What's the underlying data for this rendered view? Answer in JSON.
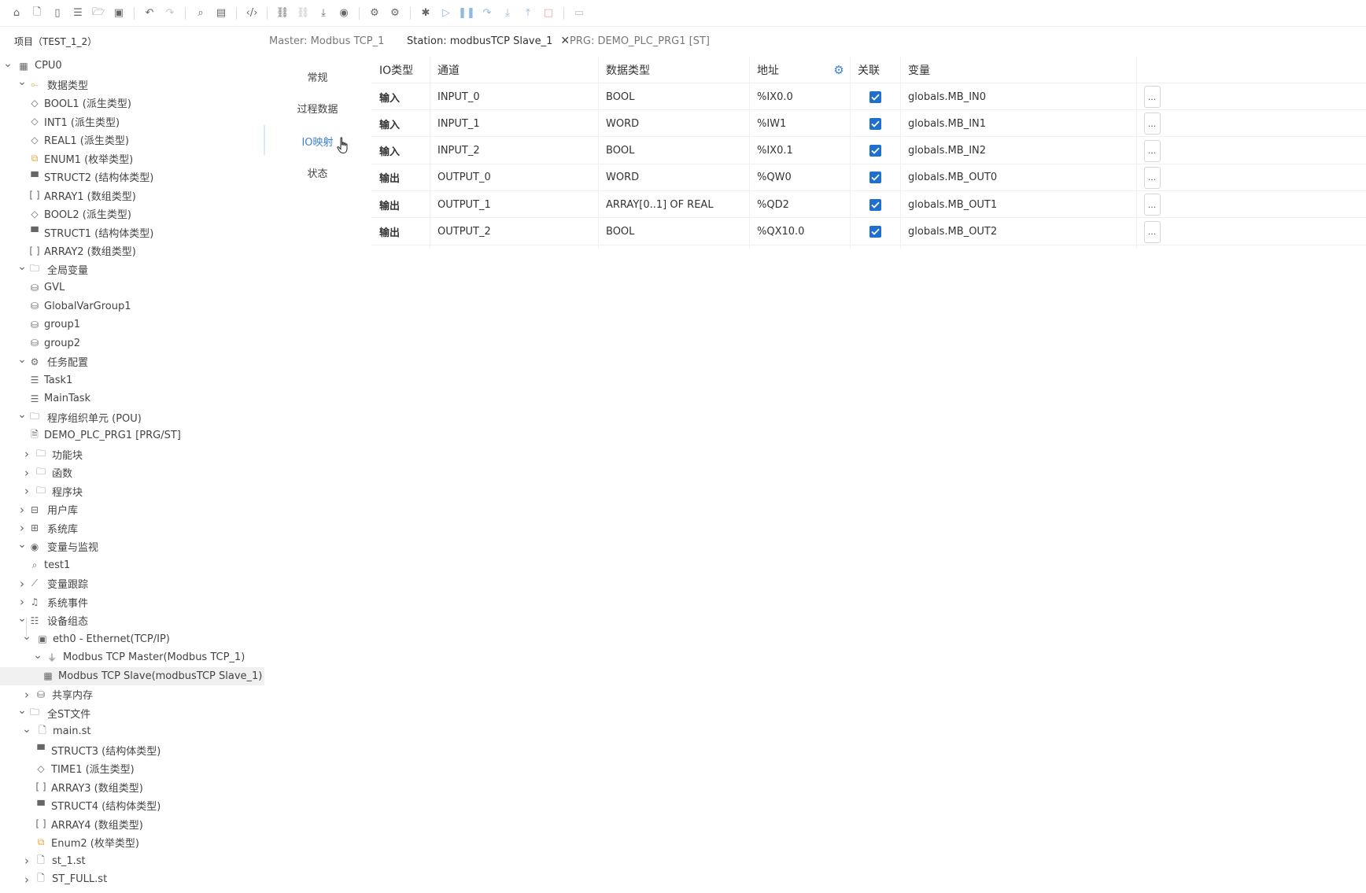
{
  "toolbar": {
    "buttons": [
      {
        "name": "home-icon",
        "glyph": "⌂"
      },
      {
        "name": "new-file-icon",
        "glyph": "🗋"
      },
      {
        "name": "device-icon",
        "glyph": "▯"
      },
      {
        "name": "list-icon",
        "glyph": "☰"
      },
      {
        "name": "open-folder-icon",
        "glyph": "🗁"
      },
      {
        "name": "save-icon",
        "glyph": "▣"
      },
      {
        "name": "undo-icon",
        "glyph": "↶"
      },
      {
        "name": "redo-icon",
        "glyph": "↷"
      },
      {
        "name": "search-icon",
        "glyph": "⌕"
      },
      {
        "name": "compile-icon",
        "glyph": "▤"
      },
      {
        "name": "code-icon",
        "glyph": "‹/›"
      },
      {
        "name": "link-icon",
        "glyph": "⛓"
      },
      {
        "name": "unlink-icon",
        "glyph": "⛓"
      },
      {
        "name": "download-icon",
        "glyph": "⤓"
      },
      {
        "name": "monitor-icon",
        "glyph": "◉"
      },
      {
        "name": "settings-icon",
        "glyph": "⚙"
      },
      {
        "name": "settings-advanced-icon",
        "glyph": "⚙"
      },
      {
        "name": "debug-icon",
        "glyph": "✱"
      },
      {
        "name": "run-icon",
        "glyph": "▷"
      },
      {
        "name": "pause-icon",
        "glyph": "❚❚"
      },
      {
        "name": "step-over-icon",
        "glyph": "↷"
      },
      {
        "name": "step-into-icon",
        "glyph": "⤓"
      },
      {
        "name": "step-out-icon",
        "glyph": "⤒"
      },
      {
        "name": "stop-icon",
        "glyph": "□"
      },
      {
        "name": "toolbox-icon",
        "glyph": "▭"
      }
    ]
  },
  "sidebar": {
    "title": "项目（TEST_1_2）",
    "tree": [
      {
        "label": "CPU0",
        "level": 0,
        "chevron": "down",
        "icon": "cpu-icon",
        "glyph": "▦"
      },
      {
        "label": "数据类型",
        "level": 1,
        "chevron": "down",
        "icon": "data-types-icon",
        "glyph": "⟜",
        "orange": true
      },
      {
        "label": "BOOL1 (派生类型)",
        "level": 2,
        "chevron": "",
        "icon": "tag-icon",
        "glyph": "◇"
      },
      {
        "label": "INT1 (派生类型)",
        "level": 2,
        "chevron": "",
        "icon": "tag-icon",
        "glyph": "◇"
      },
      {
        "label": "REAL1 (派生类型)",
        "level": 2,
        "chevron": "",
        "icon": "tag-icon",
        "glyph": "◇"
      },
      {
        "label": "ENUM1 (枚举类型)",
        "level": 2,
        "chevron": "",
        "icon": "enum-icon",
        "glyph": "⧉",
        "orange": true
      },
      {
        "label": "STRUCT2 (结构体类型)",
        "level": 2,
        "chevron": "",
        "icon": "struct-icon",
        "glyph": "▀"
      },
      {
        "label": "ARRAY1 (数组类型)",
        "level": 2,
        "chevron": "",
        "icon": "array-icon",
        "glyph": "[ ]"
      },
      {
        "label": "BOOL2 (派生类型)",
        "level": 2,
        "chevron": "",
        "icon": "tag-icon",
        "glyph": "◇"
      },
      {
        "label": "STRUCT1 (结构体类型)",
        "level": 2,
        "chevron": "",
        "icon": "struct-icon",
        "glyph": "▀"
      },
      {
        "label": "ARRAY2 (数组类型)",
        "level": 2,
        "chevron": "",
        "icon": "array-icon",
        "glyph": "[ ]"
      },
      {
        "label": "全局变量",
        "level": 1,
        "chevron": "down",
        "icon": "folder-icon",
        "glyph": "🗀"
      },
      {
        "label": "GVL",
        "level": 2,
        "chevron": "",
        "icon": "database-icon",
        "glyph": "⛁"
      },
      {
        "label": "GlobalVarGroup1",
        "level": 2,
        "chevron": "",
        "icon": "database-icon",
        "glyph": "⛁"
      },
      {
        "label": "group1",
        "level": 2,
        "chevron": "",
        "icon": "database-icon",
        "glyph": "⛁"
      },
      {
        "label": "group2",
        "level": 2,
        "chevron": "",
        "icon": "database-icon",
        "glyph": "⛁"
      },
      {
        "label": "任务配置",
        "level": 1,
        "chevron": "down",
        "icon": "gear-icon",
        "glyph": "⚙"
      },
      {
        "label": "Task1",
        "level": 2,
        "chevron": "",
        "icon": "task-list-icon",
        "glyph": "☰"
      },
      {
        "label": "MainTask",
        "level": 2,
        "chevron": "",
        "icon": "task-list-icon",
        "glyph": "☰"
      },
      {
        "label": "程序组织单元 (POU)",
        "level": 1,
        "chevron": "down",
        "icon": "folder-icon",
        "glyph": "🗀"
      },
      {
        "label": "DEMO_PLC_PRG1 [PRG/ST]",
        "level": 2,
        "chevron": "",
        "icon": "program-file-icon",
        "glyph": "🗎"
      },
      {
        "label": "功能块",
        "level": 2,
        "chevron": "right",
        "icon": "folder-icon",
        "glyph": "🗀"
      },
      {
        "label": "函数",
        "level": 2,
        "chevron": "right",
        "icon": "folder-icon",
        "glyph": "🗀"
      },
      {
        "label": "程序块",
        "level": 2,
        "chevron": "right",
        "icon": "folder-icon",
        "glyph": "🗀"
      },
      {
        "label": "用户库",
        "level": 1,
        "chevron": "right",
        "icon": "briefcase-icon",
        "glyph": "⊟"
      },
      {
        "label": "系统库",
        "level": 1,
        "chevron": "right",
        "icon": "archive-icon",
        "glyph": "⊞"
      },
      {
        "label": "变量与监视",
        "level": 1,
        "chevron": "down",
        "icon": "eye-icon",
        "glyph": "◉"
      },
      {
        "label": "test1",
        "level": 2,
        "chevron": "",
        "icon": "search-icon",
        "glyph": "⌕"
      },
      {
        "label": "变量跟踪",
        "level": 1,
        "chevron": "right",
        "icon": "chart-line-icon",
        "glyph": "⟋"
      },
      {
        "label": "系统事件",
        "level": 1,
        "chevron": "right",
        "icon": "bell-icon",
        "glyph": "♫"
      },
      {
        "label": "设备组态",
        "level": 1,
        "chevron": "down",
        "icon": "device-config-icon",
        "glyph": "☷"
      },
      {
        "label": "eth0 - Ethernet(TCP/IP)",
        "level": 2,
        "chevron": "down",
        "icon": "ethernet-icon",
        "glyph": "▣"
      },
      {
        "label": "Modbus TCP Master(Modbus TCP_1)",
        "level": 3,
        "chevron": "down",
        "icon": "plug-icon",
        "glyph": "⏚"
      },
      {
        "label": "Modbus TCP Slave(modbusTCP Slave_1)",
        "level": 4,
        "chevron": "",
        "icon": "slave-device-icon",
        "glyph": "▦",
        "selected": true
      },
      {
        "label": "共享内存",
        "level": 2,
        "chevron": "right",
        "icon": "database-icon",
        "glyph": "⛁"
      },
      {
        "label": "全ST文件",
        "level": 1,
        "chevron": "down",
        "icon": "folder-icon",
        "glyph": "🗀"
      },
      {
        "label": "main.st",
        "level": 2,
        "chevron": "down",
        "icon": "file-icon",
        "glyph": "🗋"
      },
      {
        "label": "STRUCT3 (结构体类型)",
        "level": 3,
        "chevron": "",
        "icon": "struct-icon",
        "glyph": "▀"
      },
      {
        "label": "TIME1 (派生类型)",
        "level": 3,
        "chevron": "",
        "icon": "tag-icon",
        "glyph": "◇"
      },
      {
        "label": "ARRAY3 (数组类型)",
        "level": 3,
        "chevron": "",
        "icon": "array-icon",
        "glyph": "[ ]"
      },
      {
        "label": "STRUCT4 (结构体类型)",
        "level": 3,
        "chevron": "",
        "icon": "struct-icon",
        "glyph": "▀"
      },
      {
        "label": "ARRAY4 (数组类型)",
        "level": 3,
        "chevron": "",
        "icon": "array-icon",
        "glyph": "[ ]"
      },
      {
        "label": "Enum2 (枚举类型)",
        "level": 3,
        "chevron": "",
        "icon": "enum-icon",
        "glyph": "⧉",
        "orange": true
      },
      {
        "label": "st_1.st",
        "level": 2,
        "chevron": "right",
        "icon": "file-icon",
        "glyph": "🗋"
      },
      {
        "label": "ST_FULL.st",
        "level": 2,
        "chevron": "right",
        "icon": "file-icon",
        "glyph": "🗋"
      }
    ]
  },
  "tabs": [
    {
      "label": "Master: Modbus TCP_1",
      "active": false,
      "closable": false
    },
    {
      "label": "Station: modbusTCP Slave_1",
      "active": true,
      "closable": true
    },
    {
      "label": "PRG: DEMO_PLC_PRG1 [ST]",
      "active": false,
      "closable": false
    }
  ],
  "subnav": [
    {
      "label": "常规",
      "active": false
    },
    {
      "label": "过程数据",
      "active": false
    },
    {
      "label": "IO映射",
      "active": true
    },
    {
      "label": "状态",
      "active": false
    }
  ],
  "io_table": {
    "headers": {
      "io_type": "IO类型",
      "channel": "通道",
      "data_type": "数据类型",
      "address": "地址",
      "linked": "关联",
      "variable": "变量"
    },
    "more_label": "...",
    "rows": [
      {
        "io_type": "输入",
        "channel": "INPUT_0",
        "data_type": "BOOL",
        "address": "%IX0.0",
        "linked": true,
        "variable": "globals.MB_IN0"
      },
      {
        "io_type": "输入",
        "channel": "INPUT_1",
        "data_type": "WORD",
        "address": "%IW1",
        "linked": true,
        "variable": "globals.MB_IN1"
      },
      {
        "io_type": "输入",
        "channel": "INPUT_2",
        "data_type": "BOOL",
        "address": "%IX0.1",
        "linked": true,
        "variable": "globals.MB_IN2"
      },
      {
        "io_type": "输出",
        "channel": "OUTPUT_0",
        "data_type": "WORD",
        "address": "%QW0",
        "linked": true,
        "variable": "globals.MB_OUT0"
      },
      {
        "io_type": "输出",
        "channel": "OUTPUT_1",
        "data_type": "ARRAY[0..1] OF REAL",
        "address": "%QD2",
        "linked": true,
        "variable": "globals.MB_OUT1"
      },
      {
        "io_type": "输出",
        "channel": "OUTPUT_2",
        "data_type": "BOOL",
        "address": "%QX10.0",
        "linked": true,
        "variable": "globals.MB_OUT2"
      }
    ]
  },
  "colors": {
    "accent": "#3b82d6",
    "checkbox": "#1f6fd0",
    "icon_orange": "#e8a33b",
    "selected_row": "#f0f0f0"
  }
}
